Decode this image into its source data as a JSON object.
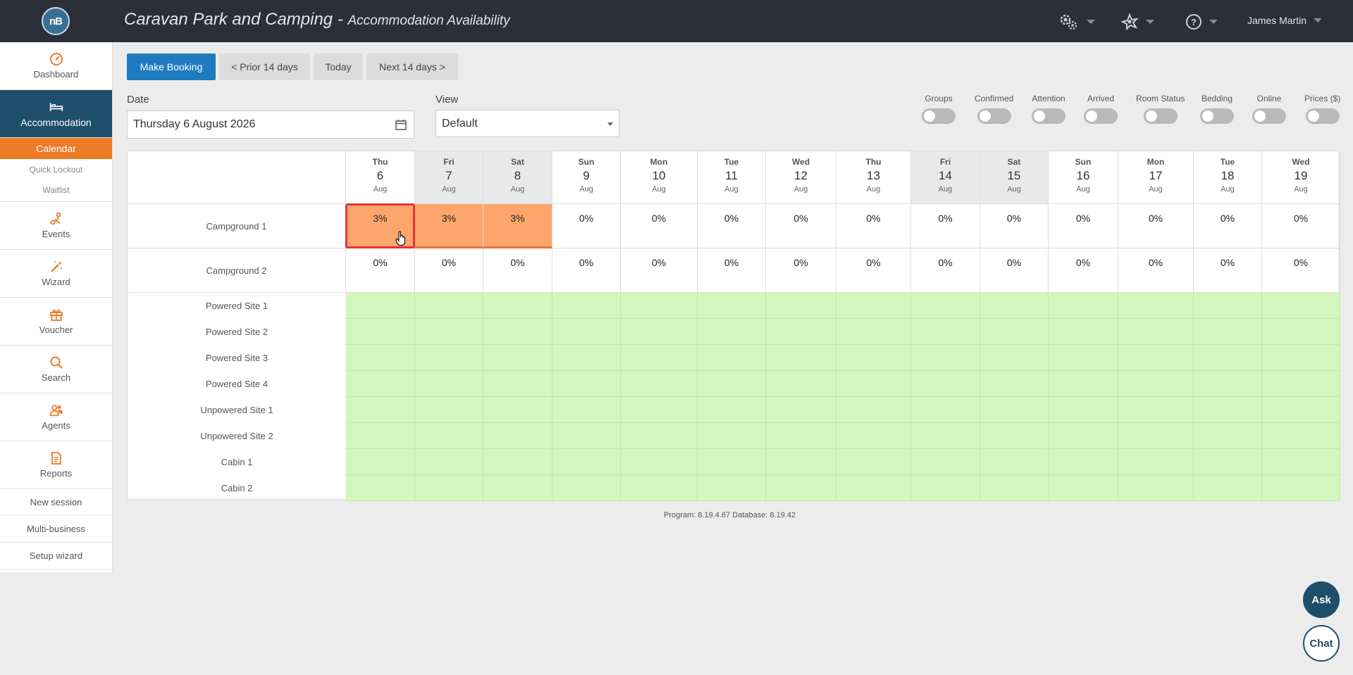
{
  "header": {
    "logo": "nB",
    "title": "Caravan Park and Camping",
    "title_separator": " - ",
    "subtitle": "Accommodation Availability",
    "user_name": "James Martin",
    "icons": [
      "settings-icon",
      "tools-icon",
      "help-icon"
    ]
  },
  "sidebar": {
    "items": [
      {
        "label": "Dashboard",
        "icon": "dashboard-icon"
      },
      {
        "label": "Accommodation",
        "icon": "bed-icon",
        "active": true
      },
      {
        "label": "Events",
        "icon": "events-icon"
      },
      {
        "label": "Wizard",
        "icon": "wand-icon"
      },
      {
        "label": "Voucher",
        "icon": "gift-icon"
      },
      {
        "label": "Search",
        "icon": "search-icon"
      },
      {
        "label": "Agents",
        "icon": "agents-icon"
      },
      {
        "label": "Reports",
        "icon": "reports-icon"
      }
    ],
    "subitems": {
      "calendar": "Calendar",
      "quick_lockout": "Quick Lockout",
      "waitlist": "Waitlist"
    },
    "links": {
      "new_session": "New session",
      "multi_business": "Multi-business",
      "setup_wizard": "Setup wizard"
    }
  },
  "toolbar": {
    "make_booking": "Make Booking",
    "prior": "< Prior 14 days",
    "today": "Today",
    "next": "Next 14 days >"
  },
  "filters": {
    "date_label": "Date",
    "date_value": "Thursday 6 August 2026",
    "view_label": "View",
    "view_value": "Default",
    "toggles": [
      "Groups",
      "Confirmed",
      "Attention",
      "Arrived",
      "Room Status",
      "Bedding",
      "Online",
      "Prices ($)"
    ]
  },
  "calendar": {
    "days": [
      {
        "dow": "Thu",
        "day": "6",
        "mon": "Aug"
      },
      {
        "dow": "Fri",
        "day": "7",
        "mon": "Aug",
        "weekend": true
      },
      {
        "dow": "Sat",
        "day": "8",
        "mon": "Aug",
        "weekend": true
      },
      {
        "dow": "Sun",
        "day": "9",
        "mon": "Aug"
      },
      {
        "dow": "Mon",
        "day": "10",
        "mon": "Aug"
      },
      {
        "dow": "Tue",
        "day": "11",
        "mon": "Aug"
      },
      {
        "dow": "Wed",
        "day": "12",
        "mon": "Aug"
      },
      {
        "dow": "Thu",
        "day": "13",
        "mon": "Aug"
      },
      {
        "dow": "Fri",
        "day": "14",
        "mon": "Aug",
        "weekend": true
      },
      {
        "dow": "Sat",
        "day": "15",
        "mon": "Aug",
        "weekend": true
      },
      {
        "dow": "Sun",
        "day": "16",
        "mon": "Aug"
      },
      {
        "dow": "Mon",
        "day": "17",
        "mon": "Aug"
      },
      {
        "dow": "Tue",
        "day": "18",
        "mon": "Aug"
      },
      {
        "dow": "Wed",
        "day": "19",
        "mon": "Aug"
      }
    ],
    "groups": [
      {
        "name": "Campground 1",
        "occupancy": [
          "3%",
          "3%",
          "3%",
          "0%",
          "0%",
          "0%",
          "0%",
          "0%",
          "0%",
          "0%",
          "0%",
          "0%",
          "0%",
          "0%"
        ],
        "booked": [
          true,
          true,
          true,
          false,
          false,
          false,
          false,
          false,
          false,
          false,
          false,
          false,
          false,
          false
        ]
      },
      {
        "name": "Campground 2",
        "occupancy": [
          "0%",
          "0%",
          "0%",
          "0%",
          "0%",
          "0%",
          "0%",
          "0%",
          "0%",
          "0%",
          "0%",
          "0%",
          "0%",
          "0%"
        ],
        "booked": [
          false,
          false,
          false,
          false,
          false,
          false,
          false,
          false,
          false,
          false,
          false,
          false,
          false,
          false
        ]
      }
    ],
    "units": [
      "Powered Site 1",
      "Powered Site 2",
      "Powered Site 3",
      "Powered Site 4",
      "Unpowered Site 1",
      "Unpowered Site 2",
      "Cabin 1",
      "Cabin 2"
    ],
    "selected": {
      "group": 0,
      "day": 0
    }
  },
  "footer": {
    "version": "Program: 8.19.4.67 Database: 8.19.42"
  },
  "floating": {
    "ask": "Ask",
    "chat": "Chat"
  },
  "colors": {
    "accent_orange": "#ec7a27",
    "nav_active": "#1f4e6b",
    "primary_button": "#1f7bbf",
    "booked": "#fda56b",
    "available": "#d2f6bb",
    "selection": "#e2363a"
  }
}
